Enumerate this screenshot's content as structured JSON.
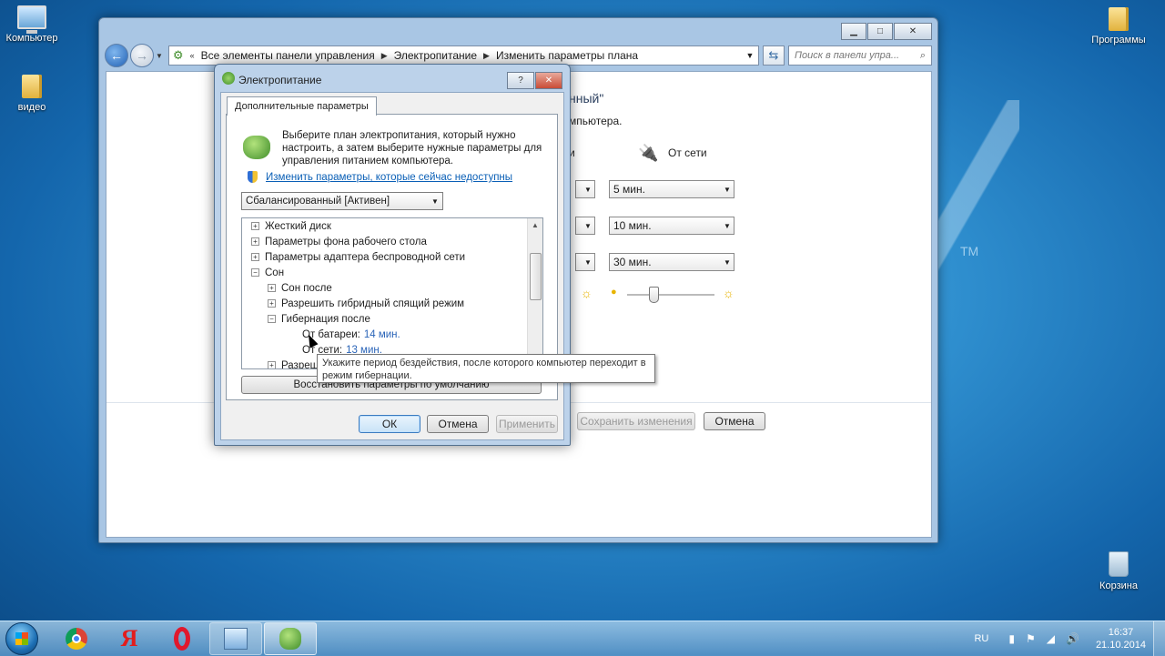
{
  "desktop": {
    "icons": [
      {
        "label": "Компьютер"
      },
      {
        "label": "видео"
      },
      {
        "label": "Программы"
      },
      {
        "label": "Корзина"
      }
    ],
    "watermark_tm": "TM"
  },
  "main_window": {
    "breadcrumb": [
      "Все элементы панели управления",
      "Электропитание",
      "Изменить параметры плана"
    ],
    "search_placeholder": "Поиск в панели упра...",
    "partial_heading": "нный\"",
    "partial_text": "мпьютера.",
    "on_battery_fragment": "и",
    "plugged_in_label": "От сети",
    "dropdowns": [
      "5 мин.",
      "10 мин.",
      "30 мин."
    ],
    "brightness": {
      "level_fraction": 0.3
    },
    "save_label": "Сохранить изменения",
    "cancel_label": "Отмена"
  },
  "dialog": {
    "title": "Электропитание",
    "help": "?",
    "tab": "Дополнительные параметры",
    "description": "Выберите план электропитания, который нужно настроить, а затем выберите нужные параметры для управления питанием компьютера.",
    "change_link": "Изменить параметры, которые сейчас недоступны",
    "plan": "Сбалансированный [Активен]",
    "tree": [
      {
        "label": "Жесткий диск",
        "level": 0,
        "expander": "+"
      },
      {
        "label": "Параметры фона рабочего стола",
        "level": 0,
        "expander": "+"
      },
      {
        "label": "Параметры адаптера беспроводной сети",
        "level": 0,
        "expander": "+"
      },
      {
        "label": "Сон",
        "level": 0,
        "expander": "−"
      },
      {
        "label": "Сон после",
        "level": 1,
        "expander": "+"
      },
      {
        "label": "Разрешить гибридный спящий режим",
        "level": 1,
        "expander": "+"
      },
      {
        "label": "Гибернация после",
        "level": 1,
        "expander": "−"
      },
      {
        "label": "От батареи:",
        "level": 2,
        "value": "14 мин."
      },
      {
        "label": "От сети:",
        "level": 2,
        "value": "13 мин."
      },
      {
        "label": "Разреши",
        "level": 1,
        "expander": "+"
      }
    ],
    "restore_label": "Восстановить параметры по умолчанию",
    "ok_label": "ОК",
    "cancel_label": "Отмена",
    "apply_label": "Применить"
  },
  "tooltip": "Укажите период бездействия, после которого компьютер переходит в режим гибернации.",
  "taskbar": {
    "language": "RU",
    "time": "16:37",
    "date": "21.10.2014",
    "yandex_letter": "Я"
  }
}
